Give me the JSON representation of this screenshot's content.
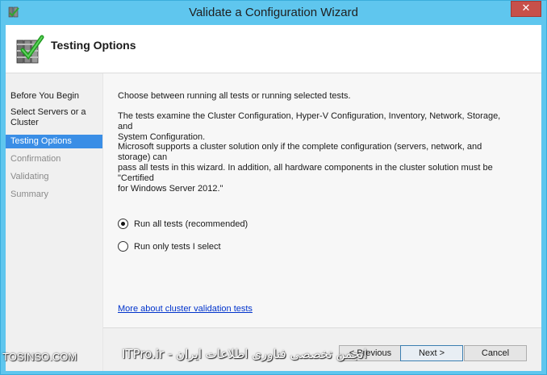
{
  "window": {
    "title": "Validate a Configuration Wizard",
    "close_glyph": "✕",
    "accent_color": "#5fc6ee"
  },
  "header": {
    "title": "Testing Options",
    "icon": "checklist-wizard-icon"
  },
  "sidebar": {
    "items": [
      {
        "label": "Before You Begin",
        "state": "done"
      },
      {
        "label": "Select Servers or a Cluster",
        "state": "done"
      },
      {
        "label": "Testing Options",
        "state": "active"
      },
      {
        "label": "Confirmation",
        "state": "pending"
      },
      {
        "label": "Validating",
        "state": "pending"
      },
      {
        "label": "Summary",
        "state": "pending"
      }
    ],
    "item_lines": {
      "select_line1": "Select Servers or a",
      "select_line2": "Cluster"
    },
    "active_color": "#3a8ee6"
  },
  "content": {
    "intro": "Choose between running all tests or running selected tests.",
    "tests_desc_line1": "The tests examine the Cluster Configuration, Hyper-V Configuration, Inventory, Network, Storage, and",
    "tests_desc_line2": "System Configuration.",
    "support_line1": "Microsoft supports a cluster solution only if the complete configuration (servers, network, and storage) can",
    "support_line2": "pass all tests in this wizard. In addition, all hardware components in the cluster solution must be \"Certified",
    "support_line3": "for Windows Server 2012.\"",
    "options": [
      {
        "label": "Run all tests (recommended)",
        "selected": true
      },
      {
        "label": "Run only tests I select",
        "selected": false
      }
    ],
    "link_text": "More about cluster validation tests"
  },
  "footer": {
    "previous_label": "< Previous",
    "next_label": "Next >",
    "cancel_label": "Cancel"
  },
  "watermarks": {
    "left": "TOSINSO.COM",
    "right": "انجمن تخصصی فناوری اطلاعات ایران - ITPro.ir"
  }
}
